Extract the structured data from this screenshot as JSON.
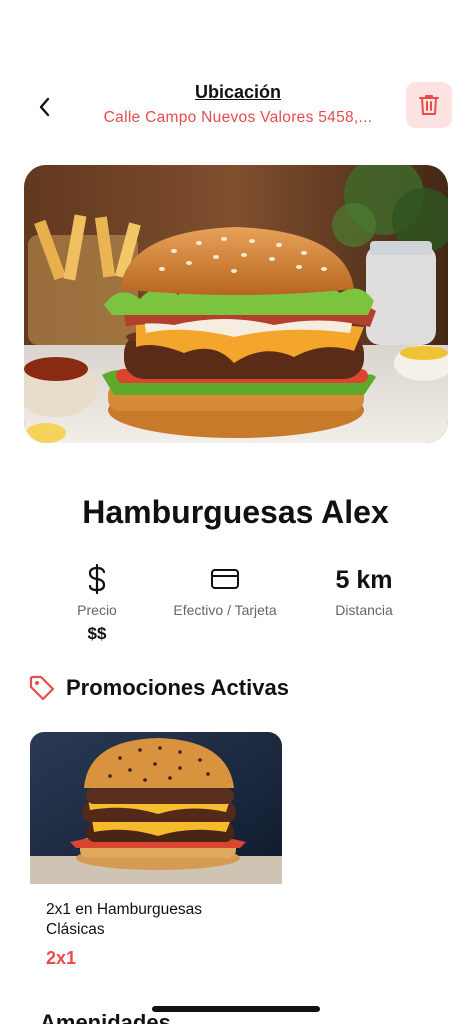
{
  "header": {
    "location_title": "Ubicación",
    "location_address": "Calle Campo Nuevos Valores 5458,..."
  },
  "restaurant": {
    "name": "Hamburguesas Alex"
  },
  "stats": {
    "price": {
      "icon": "dollar-icon",
      "label": "Precio",
      "value": "$$"
    },
    "payment": {
      "icon": "credit-card-icon",
      "label": "Efectivo / Tarjeta"
    },
    "distance": {
      "value": "5 km",
      "label": "Distancia"
    }
  },
  "promotions": {
    "title": "Promociones Activas",
    "icon": "tag-icon",
    "items": [
      {
        "name": "2x1 en Hamburguesas Clásicas",
        "badge": "2x1"
      }
    ]
  },
  "amenities": {
    "title": "Amenidades"
  },
  "colors": {
    "accent": "#e84c4c",
    "accent_soft": "#fde2e2"
  }
}
